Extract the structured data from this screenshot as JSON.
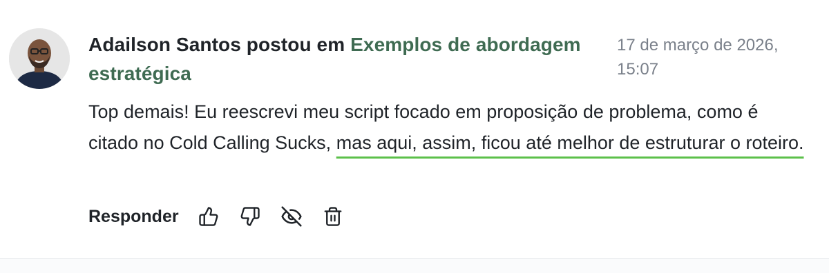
{
  "comment": {
    "author": "Adailson Santos",
    "posted_in_text": "postou em",
    "group_name": "Exemplos de abordagem estratégica",
    "timestamp": "17 de março de 2026, 15:07",
    "body_before": "Top demais! Eu reescrevi meu script focado em proposição de problema, como é citado no Cold Calling Sucks,",
    "body_highlight": "mas aqui, assim, ficou até melhor de estruturar o roteiro."
  },
  "actions": {
    "reply_label": "Responder",
    "icons": [
      "thumbs-up-icon",
      "thumbs-down-icon",
      "eye-off-icon",
      "trash-icon"
    ]
  },
  "colors": {
    "link": "#3f6b52",
    "highlight_underline": "#5cc04a",
    "timestamp": "#7a808a",
    "text": "#1f2328"
  }
}
